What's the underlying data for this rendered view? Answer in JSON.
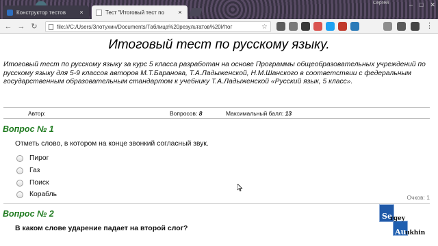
{
  "browser": {
    "tabs": [
      {
        "label": "Конструктор тестов",
        "close": "×"
      },
      {
        "label": "Тест \"Итоговый тест по",
        "close": "×"
      }
    ],
    "window_user": "Сергей",
    "window_buttons": {
      "minimize": "–",
      "maximize": "□",
      "close": "✕"
    },
    "nav": {
      "back": "←",
      "forward": "→",
      "reload": "↻"
    },
    "url": "file:///C:/Users/Злотухин/Documents/Таблица%20результатов%20Итог",
    "bookmark": "☆",
    "extension_colors": [
      "#5b5b5b",
      "#7a7a7a",
      "#3a3a3a",
      "#d9534f",
      "#1da1f2",
      "#c0392b",
      "#2a7ab8",
      "#8e8e8e",
      "#5a5a5a",
      "#444444"
    ]
  },
  "page": {
    "title": "Итоговый тест по русскому языку.",
    "description": "Итоговый тест по русскому языку за курс 5 класса разработан на основе Программы общеобразовательных учреждений по русскому языку для 5-9 классов авторов М.Т.Баранова, Т.А.Ладыженской, Н.М.Шанского в соответствии с федеральным государственным образовательным стандартом к учебнику Т.А.Ладыженской «Русский язык, 5 класс».",
    "info": {
      "author_label": "Автор:",
      "questions_label": "Вопросов:",
      "questions_value": "8",
      "max_label": "Максимальный балл:",
      "max_value": "13"
    },
    "questions": [
      {
        "heading": "Вопрос № 1",
        "text": "Отметь слово, в котором на конце звонкий согласный звук.",
        "options": [
          "Пирог",
          "Газ",
          "Поиск",
          "Корабль"
        ],
        "score": "Очков: 1"
      },
      {
        "heading": "Вопрос № 2",
        "text": "В каком слове ударение падает на второй слог?"
      }
    ]
  },
  "watermark": {
    "line1_box": "Se",
    "line1_rest": "rgey",
    "line2_box": "Au",
    "line2_rest": "ukhin"
  }
}
